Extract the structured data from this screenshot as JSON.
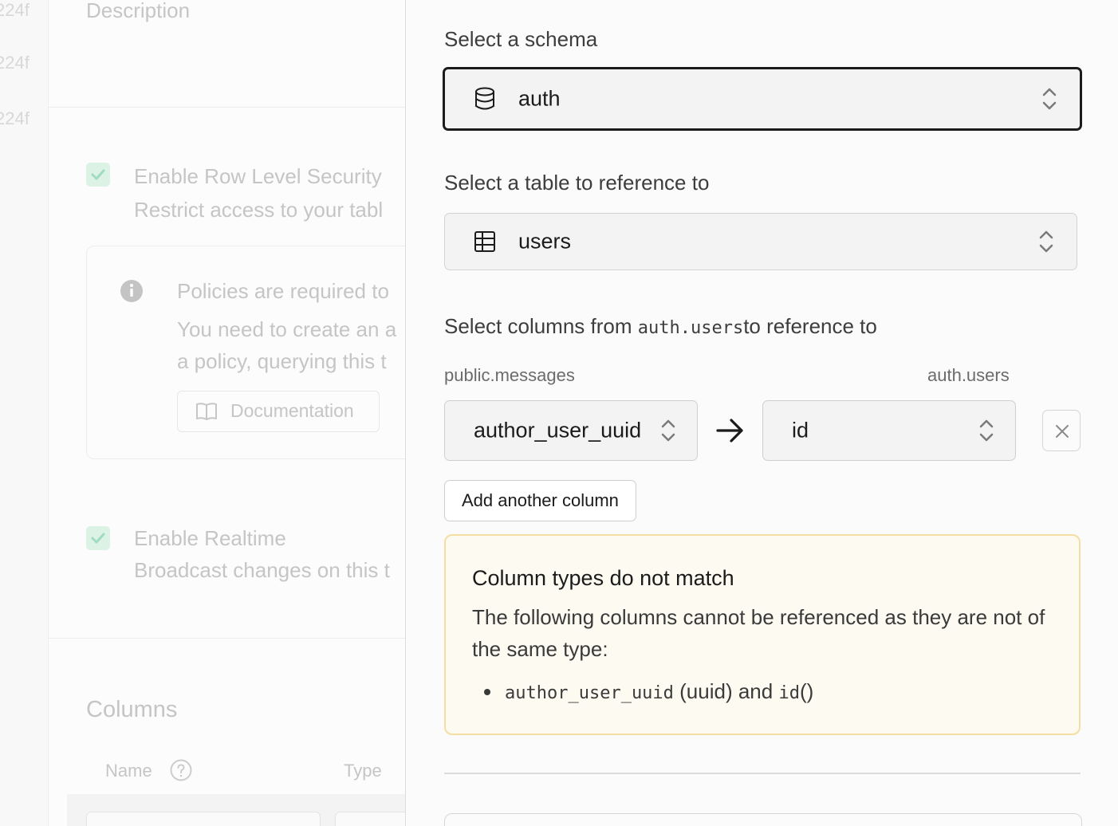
{
  "background": {
    "hash_fragments": [
      "224f",
      "224f",
      "224f"
    ],
    "description_label": "Description",
    "rls": {
      "title": "Enable Row Level Security",
      "subtitle": "Restrict access to your tabl"
    },
    "policy_notice": {
      "title": "Policies are required to",
      "line1": "You need to create an a",
      "line2": "a policy, querying this t",
      "doc_button": "Documentation"
    },
    "realtime": {
      "title": "Enable Realtime",
      "subtitle": "Broadcast changes on this t"
    },
    "columns": {
      "title": "Columns",
      "name_header": "Name",
      "type_header": "Type"
    }
  },
  "panel": {
    "schema": {
      "label": "Select a schema",
      "value": "auth"
    },
    "table": {
      "label": "Select a table to reference to",
      "value": "users"
    },
    "columns_section": {
      "label_prefix": "Select columns from ",
      "label_code": "auth.users",
      "label_suffix": "to reference to",
      "source_header": "public.messages",
      "target_header": "auth.users",
      "source_value": "author_user_uuid",
      "target_value": "id",
      "add_button": "Add another column"
    },
    "warning": {
      "title": "Column types do not match",
      "description": "The following columns cannot be referenced as they are not of the same type:",
      "item_source": "author_user_uuid",
      "item_source_type": " (uuid) and ",
      "item_target": "id",
      "item_target_type": "()"
    }
  },
  "colors": {
    "warning_border": "#f3dea3",
    "warning_bg": "#fcfaf1",
    "check_green": "#3ecf8e",
    "focus_border": "#1b1b1b"
  },
  "icons": [
    "database-icon",
    "table-icon",
    "chevron-up-down-icon",
    "arrow-right-icon",
    "close-icon",
    "info-icon",
    "book-icon",
    "check-icon",
    "help-icon"
  ]
}
